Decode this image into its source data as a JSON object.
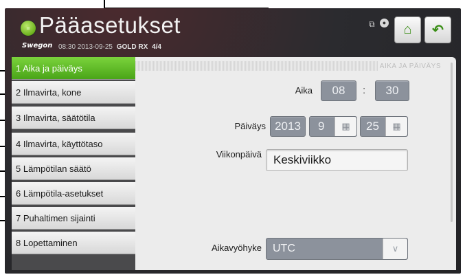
{
  "header": {
    "title": "Pääasetukset",
    "brand": "Swegon",
    "datetime": "08:30 2013-09-25",
    "model": "GOLD RX",
    "unit": "4/4",
    "icons": [
      "network-icon",
      "user-icon",
      "home-icon",
      "back-icon"
    ]
  },
  "sidebar": {
    "items": [
      {
        "label": "1 Aika ja päiväys",
        "active": true
      },
      {
        "label": "2 Ilmavirta, kone"
      },
      {
        "label": "3 Ilmavirta, säätötila"
      },
      {
        "label": "4 Ilmavirta, käyttötaso"
      },
      {
        "label": "5 Lämpötilan säätö"
      },
      {
        "label": "6 Lämpötila-asetukset"
      },
      {
        "label": "7 Puhaltimen sijainti"
      },
      {
        "label": "8 Lopettaminen"
      }
    ]
  },
  "content": {
    "section_title": "AIKA JA PÄIVÄYS",
    "time": {
      "label": "Aika",
      "hours": "08",
      "separator": ":",
      "minutes": "30"
    },
    "date": {
      "label": "Päiväys",
      "year": "2013",
      "month": "9",
      "day": "25"
    },
    "weekday": {
      "label": "Viikonpäivä",
      "value": "Keskiviikko"
    },
    "timezone": {
      "label": "Aikavyöhyke",
      "value": "UTC"
    }
  },
  "colors": {
    "accent": "#5dbb24",
    "field": "#8c929c",
    "panel": "#ececec",
    "background": "#2b2b2f"
  }
}
